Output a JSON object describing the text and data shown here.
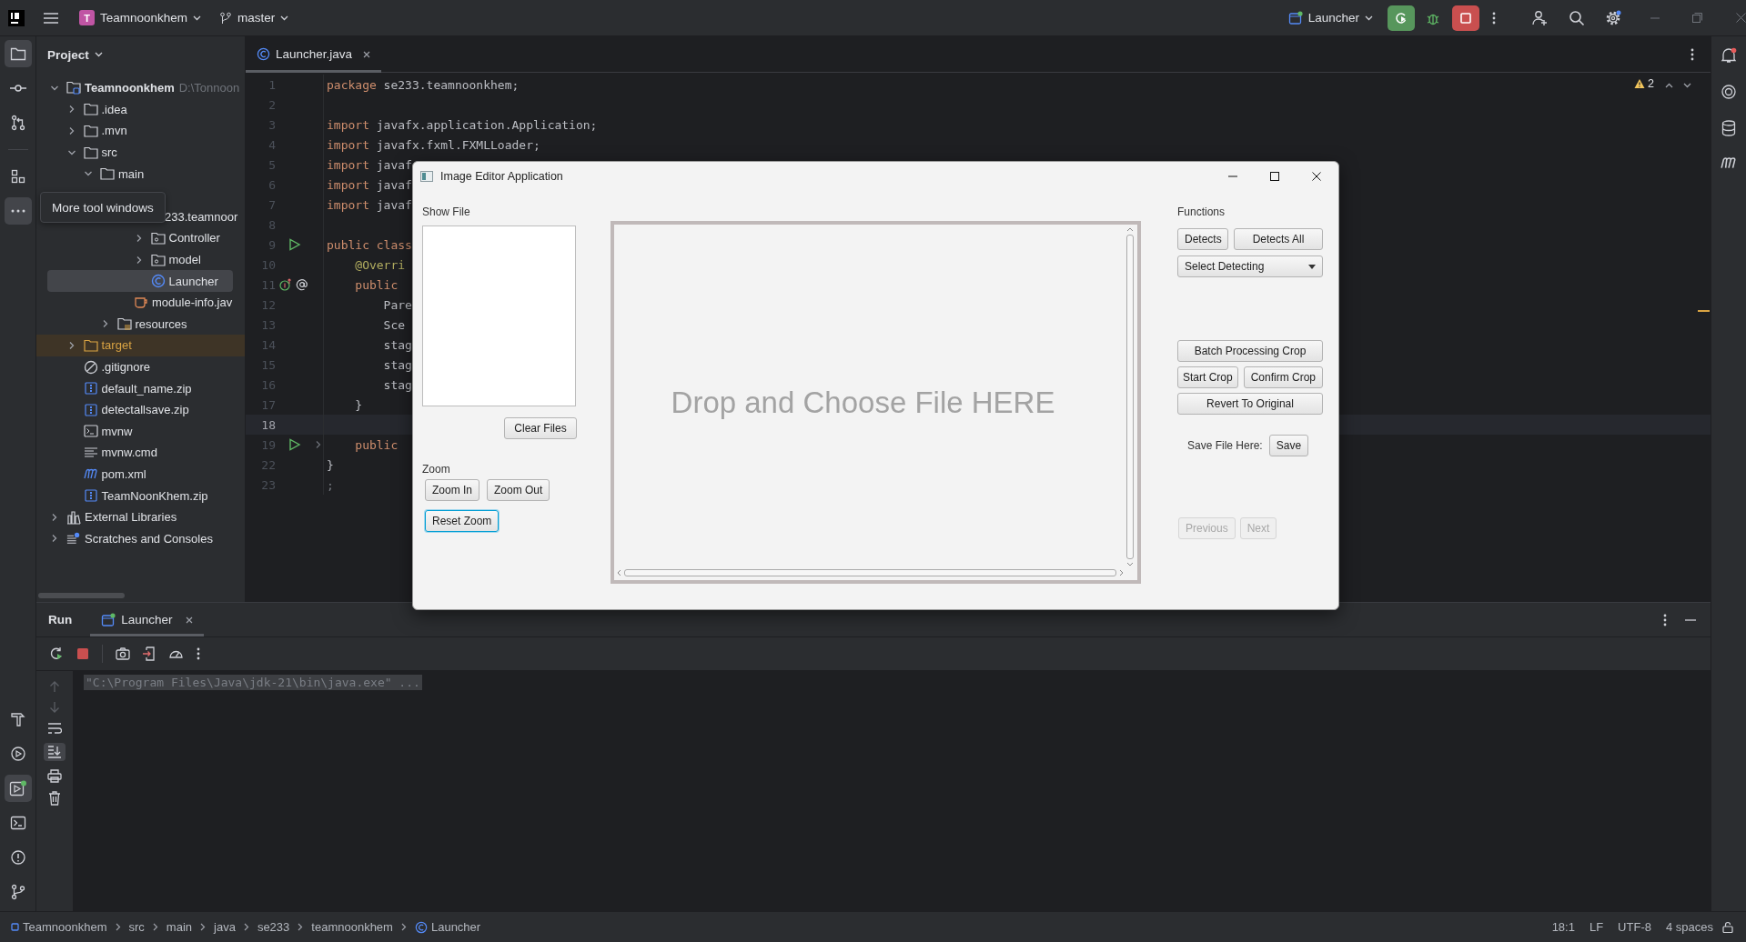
{
  "top_bar": {
    "project_initial": "T",
    "project": "Teamnoonkhem",
    "branch": "master",
    "run_config": "Launcher"
  },
  "tool_strip": {
    "top": [
      {
        "kind": "project",
        "selected": true
      },
      {
        "kind": "commit",
        "selected": false
      },
      {
        "kind": "pull-requests",
        "selected": false
      },
      {
        "kind": "structure",
        "selected": false
      },
      {
        "kind": "more",
        "selected": true
      }
    ],
    "bottom": [
      {
        "kind": "build",
        "selected": false
      },
      {
        "kind": "services",
        "selected": false
      },
      {
        "kind": "run",
        "selected": true
      },
      {
        "kind": "terminal",
        "selected": false
      },
      {
        "kind": "problems",
        "selected": false
      },
      {
        "kind": "git",
        "selected": false
      }
    ]
  },
  "tooltip": "More tool windows",
  "project_panel": {
    "title": "Project",
    "tree": [
      {
        "label": "Teamnoonkhem",
        "path": "D:\\Tonnoon",
        "kind": "module",
        "expanded": true,
        "selected": false,
        "children": [
          {
            "label": ".idea",
            "kind": "folder",
            "expanded": false,
            "selected": false
          },
          {
            "label": ".mvn",
            "kind": "folder",
            "expanded": false,
            "selected": false
          },
          {
            "label": "src",
            "kind": "folder",
            "expanded": true,
            "selected": false,
            "children": [
              {
                "label": "main",
                "kind": "folder",
                "expanded": true,
                "selected": false,
                "children": [
                  {
                    "kind": "covered",
                    "selected": false,
                    "children": [
                      {
                        "label": "233.teamnoor",
                        "kind": "covered",
                        "selected": false,
                        "children": [
                          {
                            "label": "Controller",
                            "kind": "package",
                            "expanded": false,
                            "selected": false
                          },
                          {
                            "label": "model",
                            "kind": "package",
                            "expanded": false,
                            "selected": false
                          },
                          {
                            "label": "Launcher",
                            "kind": "class",
                            "selected": true
                          }
                        ]
                      },
                      {
                        "label": "module-info.jav",
                        "kind": "module-info",
                        "selected": false
                      }
                    ]
                  },
                  {
                    "label": "resources",
                    "kind": "resources",
                    "expanded": false,
                    "selected": false
                  }
                ]
              }
            ]
          },
          {
            "label": "target",
            "kind": "excluded",
            "expanded": false,
            "selected": false
          },
          {
            "label": ".gitignore",
            "kind": "ignore",
            "selected": false
          },
          {
            "label": "default_name.zip",
            "kind": "archive",
            "selected": false
          },
          {
            "label": "detectallsave.zip",
            "kind": "archive",
            "selected": false
          },
          {
            "label": "mvnw",
            "kind": "shell",
            "selected": false
          },
          {
            "label": "mvnw.cmd",
            "kind": "text",
            "selected": false
          },
          {
            "label": "pom.xml",
            "kind": "maven",
            "selected": false
          },
          {
            "label": "TeamNoonKhem.zip",
            "kind": "archive",
            "selected": false
          }
        ]
      },
      {
        "label": "External Libraries",
        "kind": "libraries",
        "expanded": false,
        "selected": false
      },
      {
        "label": "Scratches and Consoles",
        "kind": "scratches",
        "expanded": false,
        "selected": false
      }
    ]
  },
  "editor": {
    "tabs": [
      {
        "label": "Launcher.java",
        "selected": true
      }
    ],
    "warning_count": "2",
    "lines": [
      {
        "number": "1",
        "kind": "plain",
        "current": false,
        "tokens": [
          {
            "text": "package",
            "kind": "keyword"
          },
          {
            "text": " se233.teamnoonkhem;",
            "kind": "plain"
          }
        ]
      },
      {
        "number": "2",
        "kind": "plain",
        "current": false
      },
      {
        "number": "3",
        "kind": "plain",
        "current": false,
        "tokens": [
          {
            "text": "import",
            "kind": "keyword"
          },
          {
            "text": " javafx.application.Application;",
            "kind": "plain"
          }
        ]
      },
      {
        "number": "4",
        "kind": "plain",
        "current": false,
        "tokens": [
          {
            "text": "import",
            "kind": "keyword"
          },
          {
            "text": " javafx.fxml.FXMLLoader;",
            "kind": "plain"
          }
        ]
      },
      {
        "number": "5",
        "kind": "plain",
        "current": false,
        "tokens": [
          {
            "text": "import",
            "kind": "keyword"
          },
          {
            "text": " javaf",
            "kind": "plain"
          }
        ]
      },
      {
        "number": "6",
        "kind": "plain",
        "current": false,
        "tokens": [
          {
            "text": "import",
            "kind": "keyword"
          },
          {
            "text": " javaf",
            "kind": "plain"
          }
        ]
      },
      {
        "number": "7",
        "kind": "plain",
        "current": false,
        "tokens": [
          {
            "text": "import",
            "kind": "keyword"
          },
          {
            "text": " javaf",
            "kind": "plain"
          }
        ]
      },
      {
        "number": "8",
        "kind": "plain",
        "current": false
      },
      {
        "number": "9",
        "kind": "run",
        "current": false,
        "tokens": [
          {
            "text": "public class",
            "kind": "keyword"
          }
        ]
      },
      {
        "number": "10",
        "kind": "plain",
        "current": false,
        "tokens": [
          {
            "text": "    @Overri",
            "kind": "annotation"
          }
        ]
      },
      {
        "number": "11",
        "kind": "override",
        "current": false,
        "tokens": [
          {
            "text": "    public",
            "kind": "keyword"
          }
        ]
      },
      {
        "number": "12",
        "kind": "plain",
        "current": false,
        "tokens": [
          {
            "text": "        Pare",
            "kind": "plain"
          }
        ]
      },
      {
        "number": "13",
        "kind": "plain",
        "current": false,
        "tokens": [
          {
            "text": "        Sce",
            "kind": "plain"
          }
        ]
      },
      {
        "number": "14",
        "kind": "plain",
        "current": false,
        "tokens": [
          {
            "text": "        stag",
            "kind": "plain"
          }
        ]
      },
      {
        "number": "15",
        "kind": "plain",
        "current": false,
        "tokens": [
          {
            "text": "        stag",
            "kind": "plain"
          }
        ]
      },
      {
        "number": "16",
        "kind": "plain",
        "current": false,
        "tokens": [
          {
            "text": "        stag",
            "kind": "plain"
          }
        ]
      },
      {
        "number": "17",
        "kind": "plain",
        "current": false,
        "tokens": [
          {
            "text": "    }",
            "kind": "plain"
          }
        ]
      },
      {
        "number": "18",
        "kind": "plain",
        "current": true
      },
      {
        "number": "19",
        "kind": "run-fold",
        "current": false,
        "tokens": [
          {
            "text": "    public",
            "kind": "keyword"
          }
        ]
      },
      {
        "number": "22",
        "kind": "plain",
        "current": false,
        "tokens": [
          {
            "text": "}",
            "kind": "plain"
          }
        ]
      },
      {
        "number": "23",
        "kind": "plain",
        "current": false,
        "tokens": [
          {
            "text": ";",
            "kind": "comment"
          }
        ]
      }
    ]
  },
  "dialog": {
    "title": "Image Editor Application",
    "show_file_label": "Show File",
    "clear_button": "Clear Files",
    "zoom_label": "Zoom",
    "zoom_buttons": [
      {
        "label": "Zoom In",
        "focused": false
      },
      {
        "label": "Zoom Out",
        "focused": false
      },
      {
        "label": "Reset Zoom",
        "focused": true
      }
    ],
    "drop_text": "Drop and Choose File HERE",
    "functions_label": "Functions",
    "detect_buttons": [
      "Detects",
      "Detects All"
    ],
    "select": {
      "value": "Select Detecting"
    },
    "batch_button": "Batch Processing Crop",
    "crop_buttons": [
      "Start Crop",
      "Confirm Crop"
    ],
    "revert_button": "Revert To Original",
    "save_label": "Save File Here:",
    "save_button": "Save",
    "nav_buttons": [
      {
        "label": "Previous",
        "disabled": true
      },
      {
        "label": "Next",
        "disabled": true
      }
    ]
  },
  "run_panel": {
    "title": "Run",
    "tabs": [
      {
        "label": "Launcher",
        "selected": true
      }
    ],
    "console": [
      {
        "text": "\"C:\\Program Files\\Java\\jdk-21\\bin\\java.exe\" ...",
        "selected": true
      }
    ]
  },
  "status_bar": {
    "breadcrumbs": [
      {
        "label": "Teamnoonkhem",
        "kind": "module"
      },
      {
        "label": "src",
        "kind": "plain"
      },
      {
        "label": "main",
        "kind": "plain"
      },
      {
        "label": "java",
        "kind": "plain"
      },
      {
        "label": "se233",
        "kind": "plain"
      },
      {
        "label": "teamnoonkhem",
        "kind": "plain"
      },
      {
        "label": "Launcher",
        "kind": "class"
      }
    ],
    "items": [
      "18:1",
      "LF",
      "UTF-8",
      "4 spaces"
    ]
  }
}
